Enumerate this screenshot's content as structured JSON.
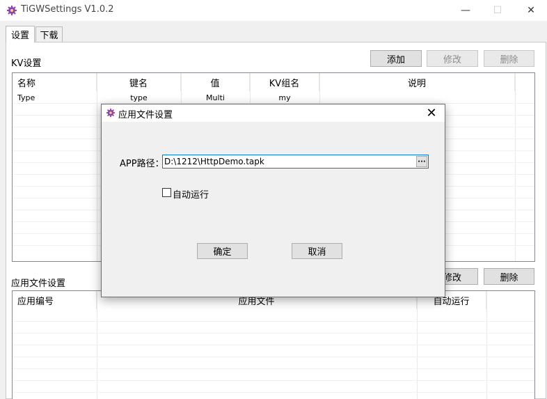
{
  "window": {
    "title": "TiGWSettings V1.0.2",
    "min_glyph": "—",
    "max_glyph": "☐",
    "close_glyph": "✕"
  },
  "tabs": [
    {
      "label": "设置"
    },
    {
      "label": "下载"
    }
  ],
  "kv": {
    "section_label": "KV设置",
    "add_label": "添加",
    "edit_label": "修改",
    "delete_label": "删除",
    "columns": [
      "名称",
      "键名",
      "值",
      "KV组名",
      "说明"
    ],
    "rows": [
      [
        "Type",
        "type",
        "Multi",
        "my",
        ""
      ]
    ]
  },
  "apps": {
    "section_label": "应用文件设置",
    "edit_label": "修改",
    "delete_label": "删除",
    "columns": [
      "应用编号",
      "应用文件",
      "自动运行"
    ]
  },
  "dialog": {
    "title": "应用文件设置",
    "close_glyph": "✕",
    "path_label": "APP路径：",
    "path_value": "D:\\1212\\HttpDemo.tapk",
    "browse_label": "···",
    "autorun_label": "自动运行",
    "autorun_checked": false,
    "ok_label": "确定",
    "cancel_label": "取消"
  },
  "colors": {
    "accent": "#0078d7",
    "icon": "#8e44ad"
  }
}
